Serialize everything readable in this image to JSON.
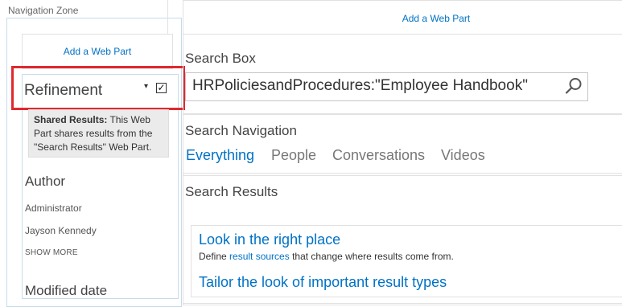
{
  "navigation_zone": {
    "label": "Navigation Zone",
    "add_web_part": "Add a Web Part",
    "refinement": {
      "title": "Refinement",
      "menu_caret": "▾",
      "checkbox_mark": "✓",
      "shared_results_bold": "Shared Results:",
      "shared_results_text": " This Web Part shares results from the \"Search Results\" Web Part.",
      "author_title": "Author",
      "authors": [
        "Administrator",
        "Jayson Kennedy"
      ],
      "show_more": "SHOW MORE",
      "modified_date_title": "Modified date"
    }
  },
  "main_zone": {
    "add_web_part": "Add a Web Part",
    "search_box": {
      "title": "Search Box",
      "query": "HRPoliciesandProcedures:\"Employee Handbook\"",
      "icon": "search-icon"
    },
    "search_navigation": {
      "title": "Search Navigation",
      "tabs": [
        {
          "label": "Everything",
          "active": true
        },
        {
          "label": "People",
          "active": false
        },
        {
          "label": "Conversations",
          "active": false
        },
        {
          "label": "Videos",
          "active": false
        }
      ]
    },
    "search_results": {
      "title": "Search Results",
      "items": [
        {
          "heading": "Look in the right place",
          "desc_prefix": "Define ",
          "desc_link": "result sources",
          "desc_suffix": " that change where results come from."
        },
        {
          "heading": "Tailor the look of important result types"
        }
      ]
    }
  },
  "colors": {
    "link": "#0072c6",
    "highlight": "#e0282f",
    "zone_border": "#c6dcea"
  }
}
